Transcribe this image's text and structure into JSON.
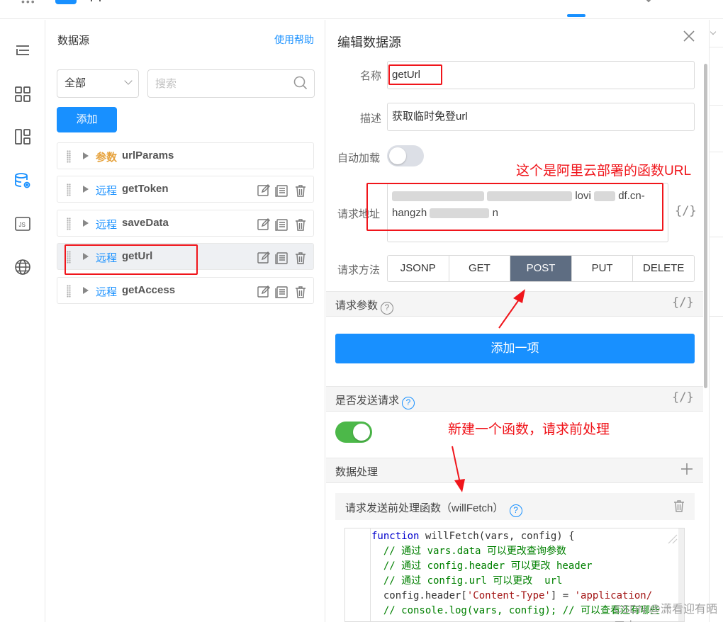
{
  "datasource_panel": {
    "title": "数据源",
    "help_link": "使用帮助",
    "filter_select": "全部",
    "search_placeholder": "搜索",
    "add_button": "添加",
    "items": [
      {
        "type": "参数",
        "name": "urlParams"
      },
      {
        "type": "远程",
        "name": "getToken"
      },
      {
        "type": "远程",
        "name": "saveData"
      },
      {
        "type": "远程",
        "name": "getUrl"
      },
      {
        "type": "远程",
        "name": "getAccess"
      }
    ]
  },
  "editor": {
    "title": "编辑数据源",
    "name_label": "名称",
    "name_value": "getUrl",
    "desc_label": "描述",
    "desc_value": "获取临时免登url",
    "autoload_label": "自动加载",
    "autoload_on": false,
    "url_label": "请求地址",
    "url_visible_1": "lovi",
    "url_visible_2": "df.cn-",
    "url_visible_3": "hangzh",
    "url_visible_4": "n",
    "expr_icon": "{/}",
    "method_label": "请求方法",
    "methods": [
      "JSONP",
      "GET",
      "POST",
      "PUT",
      "DELETE"
    ],
    "selected_method": "POST",
    "params_label": "请求参数",
    "add_item_button": "添加一项",
    "send_label": "是否发送请求",
    "send_on": true,
    "data_processing_label": "数据处理",
    "will_fetch_label": "请求发送前处理函数（willFetch）",
    "code": {
      "l1_kw": "function",
      "l1_rest": " willFetch(vars, config) {",
      "l2": "  // 通过 vars.data 可以更改查询参数",
      "l3": "  // 通过 config.header 可以更改 header",
      "l4": "  // 通过 config.url 可以更改  url",
      "l5_a": "  config.header[",
      "l5_str1": "'Content-Type'",
      "l5_b": "] = ",
      "l5_str2": "'application/",
      "l6": "  // console.log(vars, config); // 可以查看还有哪些"
    }
  },
  "annotations": {
    "url_note": "这个是阿里云部署的函数URL",
    "fn_note": "新建一个函数，请求前处理"
  },
  "watermark": "CSDN @潇看迎有晒三少",
  "colors": {
    "primary": "#1890ff",
    "annotation_red": "#f0151b",
    "toggle_on": "#4cb849",
    "method_active": "#5e6d82",
    "param_orange": "#e6a23c"
  }
}
